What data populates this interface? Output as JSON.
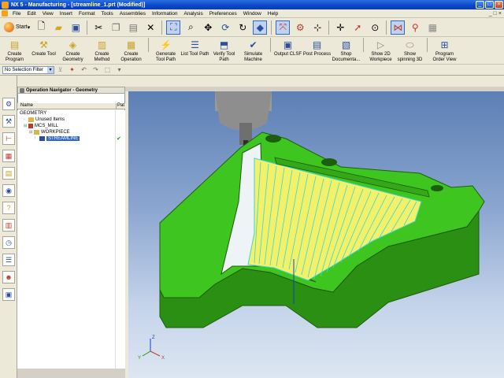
{
  "window": {
    "title": "NX 5 - Manufacturing - [streamline_1.prt (Modified)]",
    "controls": [
      "_",
      "□",
      "×"
    ]
  },
  "menu": {
    "items": [
      "File",
      "Edit",
      "View",
      "Insert",
      "Format",
      "Tools",
      "Assemblies",
      "Information",
      "Analysis",
      "Preferences",
      "Window",
      "Help"
    ],
    "right_controls": [
      "_",
      "□",
      "×"
    ]
  },
  "toolbar_top": {
    "start_label": "Start"
  },
  "toolbar_main": {
    "buttons": [
      {
        "label": "Create Program",
        "icon": "create-program-icon"
      },
      {
        "label": "Create Tool",
        "icon": "create-tool-icon"
      },
      {
        "label": "Create Geometry",
        "icon": "create-geometry-icon"
      },
      {
        "label": "Create Method",
        "icon": "create-method-icon"
      },
      {
        "label": "Create Operation",
        "icon": "create-operation-icon"
      },
      {
        "label": "Generate Tool Path",
        "icon": "generate-toolpath-icon"
      },
      {
        "label": "List Tool Path",
        "icon": "list-toolpath-icon"
      },
      {
        "label": "Verify Tool Path",
        "icon": "verify-toolpath-icon"
      },
      {
        "label": "Simulate Machine",
        "icon": "simulate-machine-icon"
      },
      {
        "label": "Output CLSF",
        "icon": "output-clsf-icon"
      },
      {
        "label": "Post Process",
        "icon": "post-process-icon"
      },
      {
        "label": "Shop Documenta...",
        "icon": "shop-doc-icon"
      },
      {
        "label": "Show 2D Workpiece",
        "icon": "show-2d-icon"
      },
      {
        "label": "Show spinning 3D",
        "icon": "show-3d-icon"
      },
      {
        "label": "Program Order View",
        "icon": "program-order-icon"
      }
    ]
  },
  "selection": {
    "filter": "No Selection Filter"
  },
  "navigator": {
    "title": "Operation Navigator - Geometry",
    "columns": [
      "Name",
      "Pat"
    ],
    "tree": [
      {
        "label": "GEOMETRY",
        "indent": 0
      },
      {
        "label": "Unused Items",
        "indent": 1
      },
      {
        "label": "MCS_MILL",
        "indent": 1
      },
      {
        "label": "WORKPIECE",
        "indent": 2
      },
      {
        "label": "STREAMLINE",
        "indent": 3,
        "selected": true
      }
    ]
  },
  "colors": {
    "part_green": "#3fc51f",
    "part_dark": "#2a8f12",
    "toolpath_yellow": "#f2f26a",
    "toolpath_cyan": "#3bd5d5",
    "viewport_top": "#5c7fb5",
    "viewport_bottom": "#dde6f2",
    "selection_blue": "#316ac5"
  },
  "viewport": {
    "triad_labels": [
      "Z",
      "X",
      "Y"
    ]
  }
}
